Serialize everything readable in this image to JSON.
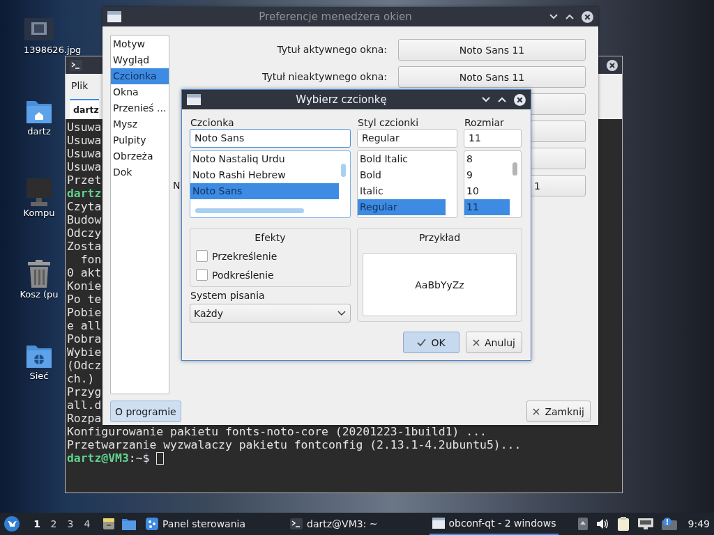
{
  "desktop": {
    "icons": [
      {
        "kind": "image",
        "label": "1398626.jpg"
      },
      {
        "kind": "home",
        "label": "dartz"
      },
      {
        "kind": "computer",
        "label": "Kompu"
      },
      {
        "kind": "trash",
        "label": "Kosz (pu"
      },
      {
        "kind": "network",
        "label": "Sieć"
      }
    ]
  },
  "terminal": {
    "menu": [
      "Plik"
    ],
    "tab": "dartz",
    "lines": [
      {
        "kind": "text",
        "text": "Usuwa"
      },
      {
        "kind": "text",
        "text": "Usuwa"
      },
      {
        "kind": "text",
        "text": "Usuwa"
      },
      {
        "kind": "text",
        "text": "Usuwa"
      },
      {
        "kind": "text",
        "text": "Przet"
      },
      {
        "kind": "prompt",
        "user": "dartz"
      },
      {
        "kind": "text",
        "text": "Czyta"
      },
      {
        "kind": "text",
        "text": "Budow"
      },
      {
        "kind": "text",
        "text": "Odczy"
      },
      {
        "kind": "text",
        "text": "Zosta"
      },
      {
        "kind": "text",
        "text": "  fon"
      },
      {
        "kind": "text",
        "text": "0 akt"
      },
      {
        "kind": "text",
        "text": "Konie"
      },
      {
        "kind": "text",
        "text": "Po te"
      },
      {
        "kind": "text",
        "text": "Pobie"
      },
      {
        "kind": "text",
        "text": "e all"
      },
      {
        "kind": "text",
        "text": "Pobra"
      },
      {
        "kind": "text",
        "text": "Wybie"
      },
      {
        "kind": "text",
        "text": "(Odcz"
      },
      {
        "kind": "text",
        "text": "ch.)"
      },
      {
        "kind": "text",
        "text": "Przyg"
      },
      {
        "kind": "text",
        "text": "all.d"
      },
      {
        "kind": "text",
        "text": "Rozpa"
      },
      {
        "kind": "text",
        "text": "Konfigurowanie pakietu fonts-noto-core (20201223-1build1) ..."
      },
      {
        "kind": "text",
        "text": "Przetwarzanie wyzwalaczy pakietu fontconfig (2.13.1-4.2ubuntu5)..."
      },
      {
        "kind": "prompt",
        "user": "dartz@VM3",
        "path": ":~$",
        "cursor": true
      }
    ]
  },
  "preferences": {
    "title": "Preferencje menedżera okien",
    "sidebar": [
      {
        "label": "Motyw",
        "selected": false
      },
      {
        "label": "Wygląd",
        "selected": false
      },
      {
        "label": "Czcionka",
        "selected": true
      },
      {
        "label": "Okna",
        "selected": false
      },
      {
        "label": "Przenieś ...",
        "selected": false
      },
      {
        "label": "Mysz",
        "selected": false
      },
      {
        "label": "Pulpity",
        "selected": false
      },
      {
        "label": "Obrzeża",
        "selected": false
      },
      {
        "label": "Dok",
        "selected": false
      }
    ],
    "rows": [
      {
        "kind": "full",
        "label": "Tytuł aktywnego okna:",
        "value": "Noto Sans 11"
      },
      {
        "kind": "full",
        "label": "Tytuł nieaktywnego okna:",
        "value": "Noto Sans 11"
      },
      {
        "kind": "hidden"
      },
      {
        "kind": "hidden"
      },
      {
        "kind": "hidden"
      },
      {
        "kind": "partial",
        "label": "N",
        "value": "1"
      }
    ],
    "about_button": "O programie",
    "close_button": "Zamknij"
  },
  "font_dialog": {
    "title": "Wybierz czcionkę",
    "family": {
      "label": "Czcionka",
      "value": "Noto Sans",
      "items": [
        {
          "label": "Noto Nastaliq Urdu",
          "selected": false
        },
        {
          "label": "Noto Rashi Hebrew",
          "selected": false
        },
        {
          "label": "Noto Sans",
          "selected": true
        }
      ]
    },
    "style": {
      "label": "Styl czcionki",
      "value": "Regular",
      "items": [
        {
          "label": "Bold Italic",
          "selected": false
        },
        {
          "label": "Bold",
          "selected": false
        },
        {
          "label": "Italic",
          "selected": false
        },
        {
          "label": "Regular",
          "selected": true
        }
      ]
    },
    "size": {
      "label": "Rozmiar",
      "value": "11",
      "items": [
        {
          "label": "8",
          "selected": false
        },
        {
          "label": "9",
          "selected": false
        },
        {
          "label": "10",
          "selected": false
        },
        {
          "label": "11",
          "selected": true
        }
      ]
    },
    "effects": {
      "title": "Efekty",
      "options": [
        {
          "label": "Przekreślenie",
          "checked": false
        },
        {
          "label": "Podkreślenie",
          "checked": false
        }
      ]
    },
    "writing_system": {
      "label": "System pisania",
      "value": "Każdy"
    },
    "sample": {
      "title": "Przykład",
      "text": "AaBbYyZz"
    },
    "ok_button": "OK",
    "cancel_button": "Anuluj"
  },
  "taskbar": {
    "workspaces": [
      {
        "label": "1",
        "selected": true
      },
      {
        "label": "2",
        "selected": false
      },
      {
        "label": "3",
        "selected": false
      },
      {
        "label": "4",
        "selected": false
      }
    ],
    "tasks": [
      {
        "kind": "control-panel",
        "label": "Panel sterowania",
        "selected": false
      },
      {
        "kind": "terminal",
        "label": "dartz@VM3: ~",
        "selected": false
      },
      {
        "kind": "window",
        "label": "obconf-qt - 2 windows",
        "selected": true
      }
    ],
    "clock": "9:49"
  }
}
